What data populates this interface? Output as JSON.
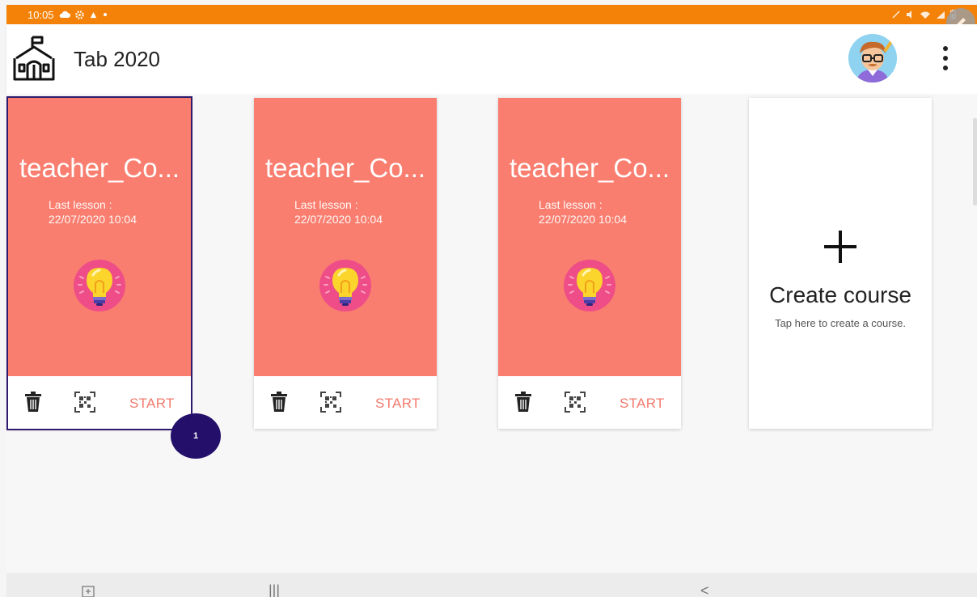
{
  "status_bar": {
    "time": "10:05",
    "icons_left": [
      "cloud-icon",
      "settings-icon",
      "app-icon",
      "dot-icon"
    ],
    "icons_right": [
      "edit-icon",
      "mute-icon",
      "wifi-icon",
      "signal-icon",
      "battery-icon"
    ],
    "color": "#f58208"
  },
  "app_bar": {
    "title": "Tab 2020",
    "logo_icon": "school-icon",
    "avatar_icon": "teacher-avatar-icon",
    "menu_icon": "more-vert-icon"
  },
  "courses": [
    {
      "name": "teacher_Co...",
      "last_lesson_label": "Last lesson :",
      "last_lesson_date": "22/07/2020 10:04",
      "icon": "lightbulb-icon",
      "start_label": "START",
      "selected": true
    },
    {
      "name": "teacher_Co...",
      "last_lesson_label": "Last lesson :",
      "last_lesson_date": "22/07/2020 10:04",
      "icon": "lightbulb-icon",
      "start_label": "START",
      "selected": false
    },
    {
      "name": "teacher_Co...",
      "last_lesson_label": "Last lesson :",
      "last_lesson_date": "22/07/2020 10:04",
      "icon": "lightbulb-icon",
      "start_label": "START",
      "selected": false
    }
  ],
  "create_card": {
    "plus": "+",
    "title": "Create course",
    "subtitle": "Tap here to create a course."
  },
  "badge": {
    "text": "1",
    "color": "#24106a"
  },
  "colors": {
    "card_top": "#f97e6f",
    "start_text": "#f37a6d",
    "selected_border": "#2e1a6e"
  },
  "nav_bar": {
    "recent": "|||",
    "back": "<"
  }
}
